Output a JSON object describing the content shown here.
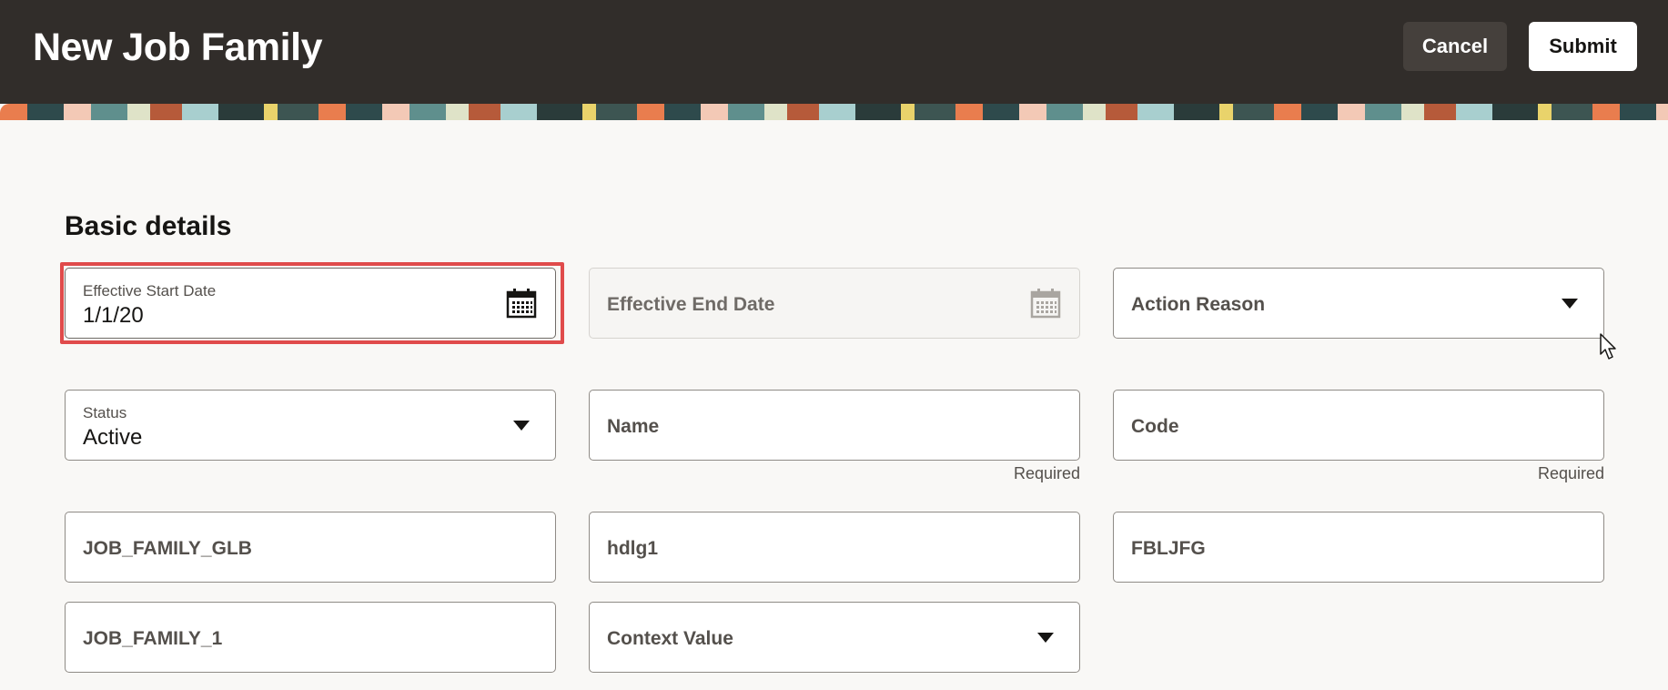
{
  "header": {
    "title": "New Job Family",
    "cancel_label": "Cancel",
    "submit_label": "Submit"
  },
  "section": {
    "title": "Basic details"
  },
  "fields": {
    "effective_start_date": {
      "label": "Effective Start Date",
      "value": "1/1/20",
      "icon": "calendar-icon"
    },
    "effective_end_date": {
      "placeholder": "Effective End Date",
      "icon": "calendar-icon",
      "disabled": true
    },
    "action_reason": {
      "placeholder": "Action Reason",
      "icon": "chevron-down-icon"
    },
    "status": {
      "label": "Status",
      "value": "Active",
      "icon": "chevron-down-icon"
    },
    "name": {
      "placeholder": "Name",
      "hint": "Required"
    },
    "code": {
      "placeholder": "Code",
      "hint": "Required"
    },
    "flex_1": {
      "placeholder": "JOB_FAMILY_GLB"
    },
    "flex_2": {
      "placeholder": "hdlg1"
    },
    "flex_3": {
      "placeholder": "FBLJFG"
    },
    "flex_4": {
      "placeholder": "JOB_FAMILY_1"
    },
    "context_value": {
      "placeholder": "Context Value",
      "icon": "chevron-down-icon"
    }
  },
  "colors": {
    "header_bg": "#312d2a",
    "page_bg": "#f9f8f6",
    "focus_ring": "#e04b4b"
  }
}
